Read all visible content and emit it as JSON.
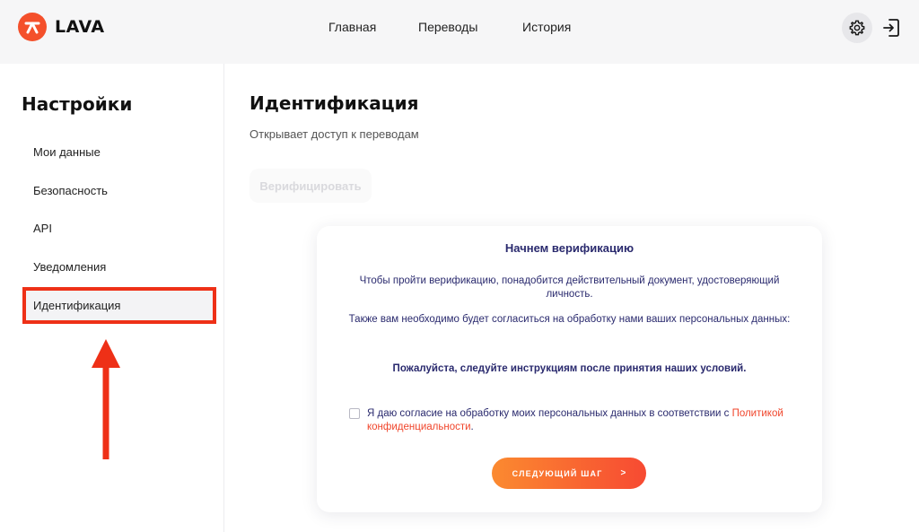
{
  "header": {
    "logo_text": "LAVA",
    "nav": [
      {
        "label": "Главная"
      },
      {
        "label": "Переводы"
      },
      {
        "label": "История"
      }
    ]
  },
  "sidebar": {
    "title": "Настройки",
    "items": [
      {
        "label": "Мои данные"
      },
      {
        "label": "Безопасность"
      },
      {
        "label": "API"
      },
      {
        "label": "Уведомления"
      },
      {
        "label": "Идентификация",
        "active": true
      }
    ]
  },
  "main": {
    "title": "Идентификация",
    "subtitle": "Открывает доступ к переводам",
    "verify_button": "Верифицировать"
  },
  "modal": {
    "title": "Начнем верификацию",
    "paragraph1": "Чтобы пройти верификацию, понадобится действительный документ, удостоверяющий личность.",
    "paragraph2": "Также вам необходимо будет согласиться на обработку нами ваших персональных данных:",
    "instruction": "Пожалуйста, следуйте инструкциям после принятия наших условий.",
    "consent_text": "Я даю согласие на обработку моих персональных данных в соответствии с ",
    "consent_link": "Политикой конфиденциальности",
    "consent_end": ".",
    "checkbox_checked": false,
    "next_button": "СЛЕДУЮЩИЙ ШАГ",
    "next_chevron": ">"
  },
  "icons": {
    "logo": "lava-logo-icon",
    "settings": "gear-icon",
    "logout": "logout-icon",
    "annotation_arrow": "red-arrow-up-icon"
  },
  "colors": {
    "accent": "#f4502b",
    "highlight_border": "#ee3017",
    "modal_text": "#2a2a6e",
    "link": "#f0452b"
  }
}
